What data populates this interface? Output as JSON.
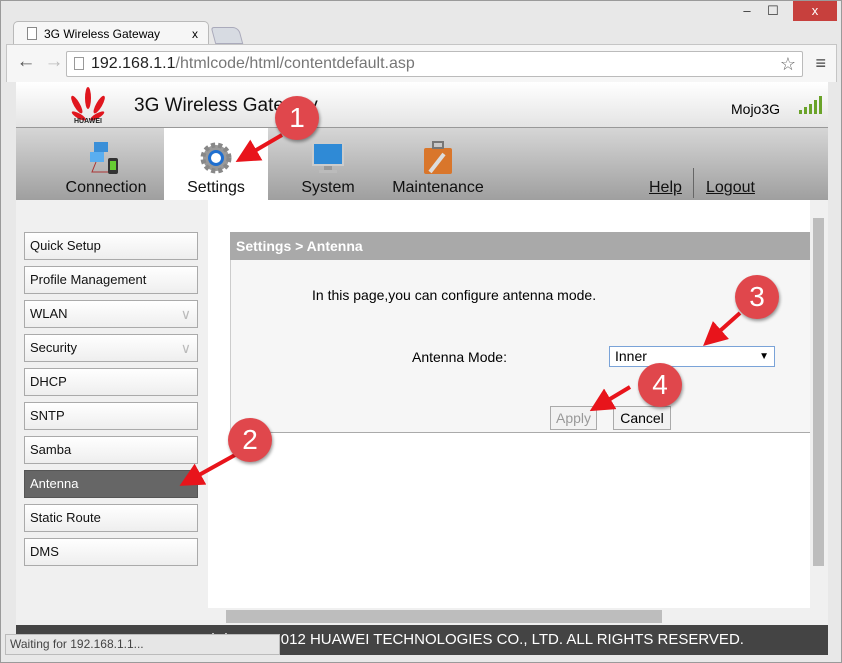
{
  "browser": {
    "tab_title": "3G Wireless Gateway",
    "tab_close": "x",
    "url_host": "192.168.1.1",
    "url_path": "/htmlcode/html/contentdefault.asp",
    "minimize": "–",
    "maximize": "☐",
    "close": "x",
    "back": "←",
    "forward": "→",
    "reload": "↻",
    "star": "☆",
    "menu": "≡"
  },
  "header": {
    "logo_text": "HUAWEI",
    "title": "3G Wireless Gateway",
    "user": "Mojo3G",
    "signal_level": 5
  },
  "nav": {
    "items": [
      {
        "label": "Connection",
        "icon": "connection-icon"
      },
      {
        "label": "Settings",
        "icon": "gear-icon",
        "active": true
      },
      {
        "label": "System",
        "icon": "monitor-icon"
      },
      {
        "label": "Maintenance",
        "icon": "toolbox-icon"
      }
    ],
    "help": "Help",
    "logout": "Logout"
  },
  "sidebar": {
    "items": [
      {
        "label": "Quick Setup"
      },
      {
        "label": "Profile Management"
      },
      {
        "label": "WLAN",
        "expand": true
      },
      {
        "label": "Security",
        "expand": true
      },
      {
        "label": "DHCP"
      },
      {
        "label": "SNTP"
      },
      {
        "label": "Samba"
      },
      {
        "label": "Antenna",
        "selected": true
      },
      {
        "label": "Static Route"
      },
      {
        "label": "DMS"
      }
    ],
    "chevron": "∨"
  },
  "panel": {
    "title": "Settings > Antenna",
    "intro": "In this page,you can configure antenna mode.",
    "field_label": "Antenna Mode:",
    "field_value": "Inner",
    "apply": "Apply",
    "cancel": "Cancel"
  },
  "footer": {
    "copyright": "COPYRIGHT (C) 2006-2012 HUAWEI TECHNOLOGIES CO., LTD. ALL RIGHTS RESERVED."
  },
  "status": "Waiting for 192.168.1.1...",
  "annotations": [
    "1",
    "2",
    "3",
    "4"
  ],
  "colors": {
    "annotation": "#e0474c",
    "selected_item": "#666666",
    "panel_header": "#a9a9a9"
  }
}
